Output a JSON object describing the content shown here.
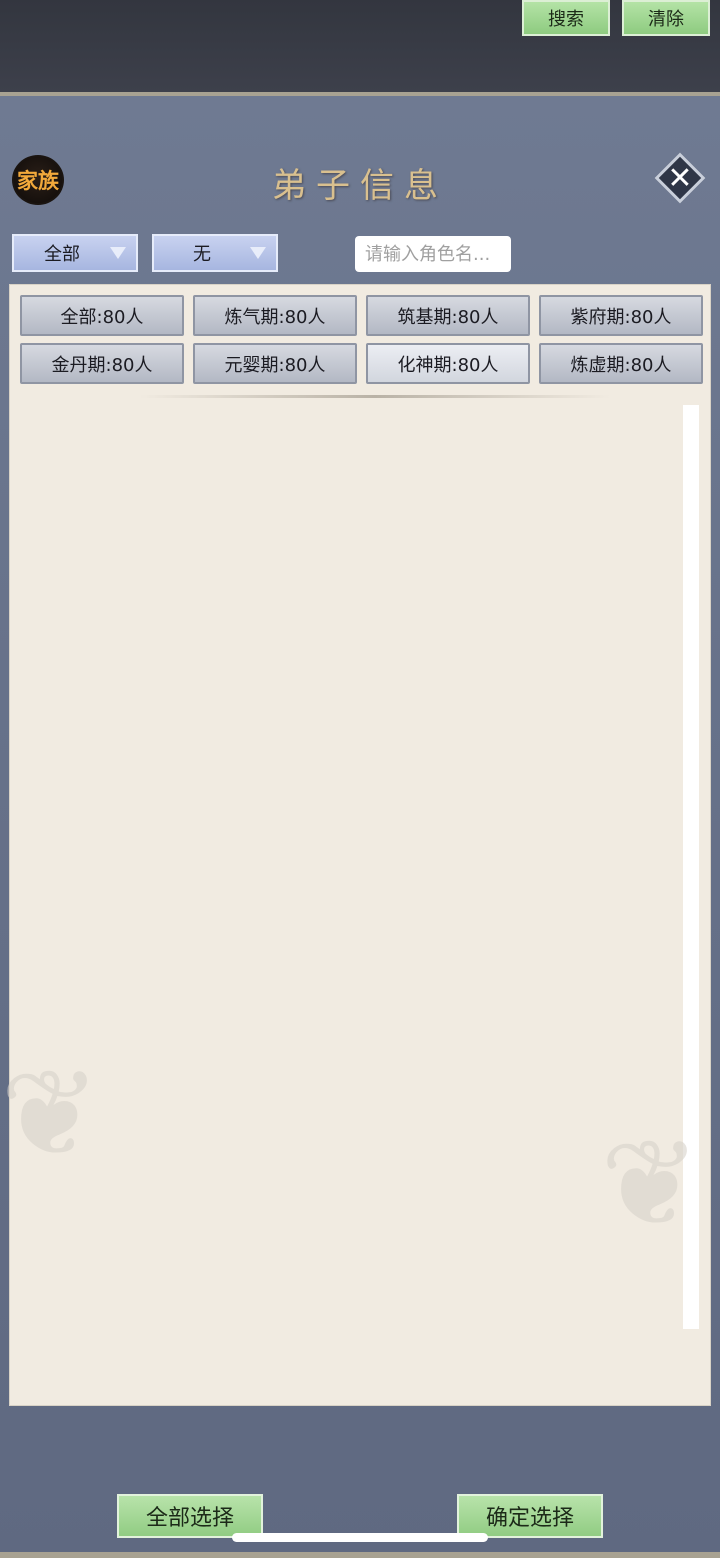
{
  "header": {
    "family_badge": "家族",
    "title": "弟子信息",
    "close_icon": "close-icon"
  },
  "toolbar": {
    "dropdown1": "全部",
    "dropdown2": "无",
    "search_placeholder": "请输入角色名...",
    "search_label": "搜索",
    "clear_label": "清除"
  },
  "filters": [
    "全部:80人",
    "炼气期:80人",
    "筑基期:80人",
    "紫府期:80人",
    "金丹期:80人",
    "元婴期:80人",
    "化神期:80人",
    "炼虚期:80人"
  ],
  "footer": {
    "select_all": "全部选择",
    "confirm": "确定选择"
  }
}
